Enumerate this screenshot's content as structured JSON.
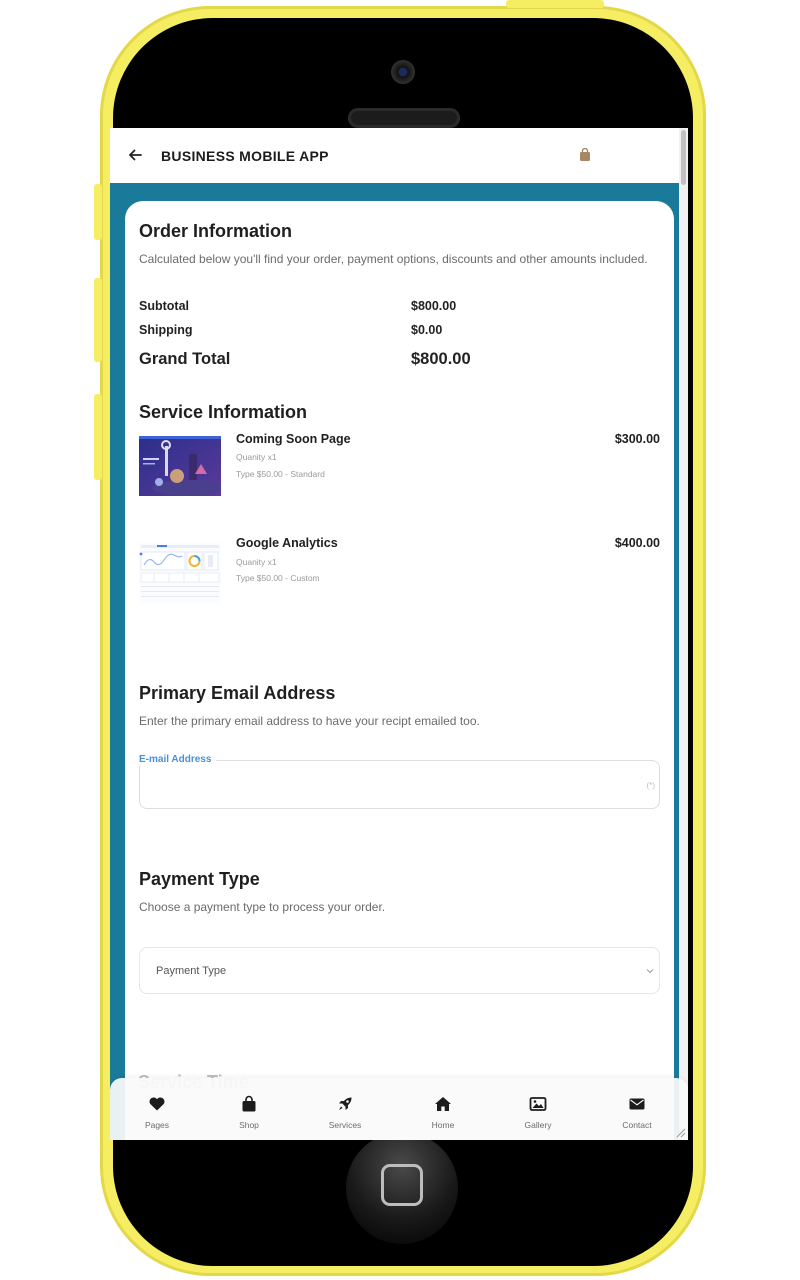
{
  "app": {
    "title": "BUSINESS MOBILE APP"
  },
  "icons": {
    "back": "arrow-left-icon",
    "cart": "shopping-bag-icon",
    "dropdown": "chevron-down-icon"
  },
  "colors": {
    "frame": "#f6ee62",
    "screen_background": "#1a7a99",
    "field_label": "#4a8fd8"
  },
  "order": {
    "heading": "Order Information",
    "description": "Calculated below you'll find your order, payment options, discounts and other amounts included.",
    "rows": [
      {
        "label": "Subtotal",
        "value": "$800.00"
      },
      {
        "label": "Shipping",
        "value": "$0.00"
      },
      {
        "label": "Grand Total",
        "value": "$800.00"
      }
    ]
  },
  "services": {
    "heading": "Service Information",
    "items": [
      {
        "name": "Coming Soon Page",
        "quantity": "Quanity x1",
        "type": "Type $50.00 - Standard",
        "price": "$300.00"
      },
      {
        "name": "Google Analytics",
        "quantity": "Quanity x1",
        "type": "Type $50.00 - Custom",
        "price": "$400.00"
      }
    ]
  },
  "email": {
    "heading": "Primary Email Address",
    "description": "Enter the primary email address to have your recipt emailed too.",
    "label": "E-mail Address",
    "value": "",
    "required_marker": "(*)"
  },
  "payment": {
    "heading": "Payment Type",
    "description": "Choose a payment type to process your order.",
    "selected": "Payment Type"
  },
  "next_section": {
    "heading": "Service Time"
  },
  "nav": [
    {
      "label": "Pages",
      "icon": "heart-icon"
    },
    {
      "label": "Shop",
      "icon": "shopping-bag-icon"
    },
    {
      "label": "Services",
      "icon": "rocket-icon"
    },
    {
      "label": "Home",
      "icon": "home-icon"
    },
    {
      "label": "Gallery",
      "icon": "image-icon"
    },
    {
      "label": "Contact",
      "icon": "envelope-icon"
    }
  ]
}
